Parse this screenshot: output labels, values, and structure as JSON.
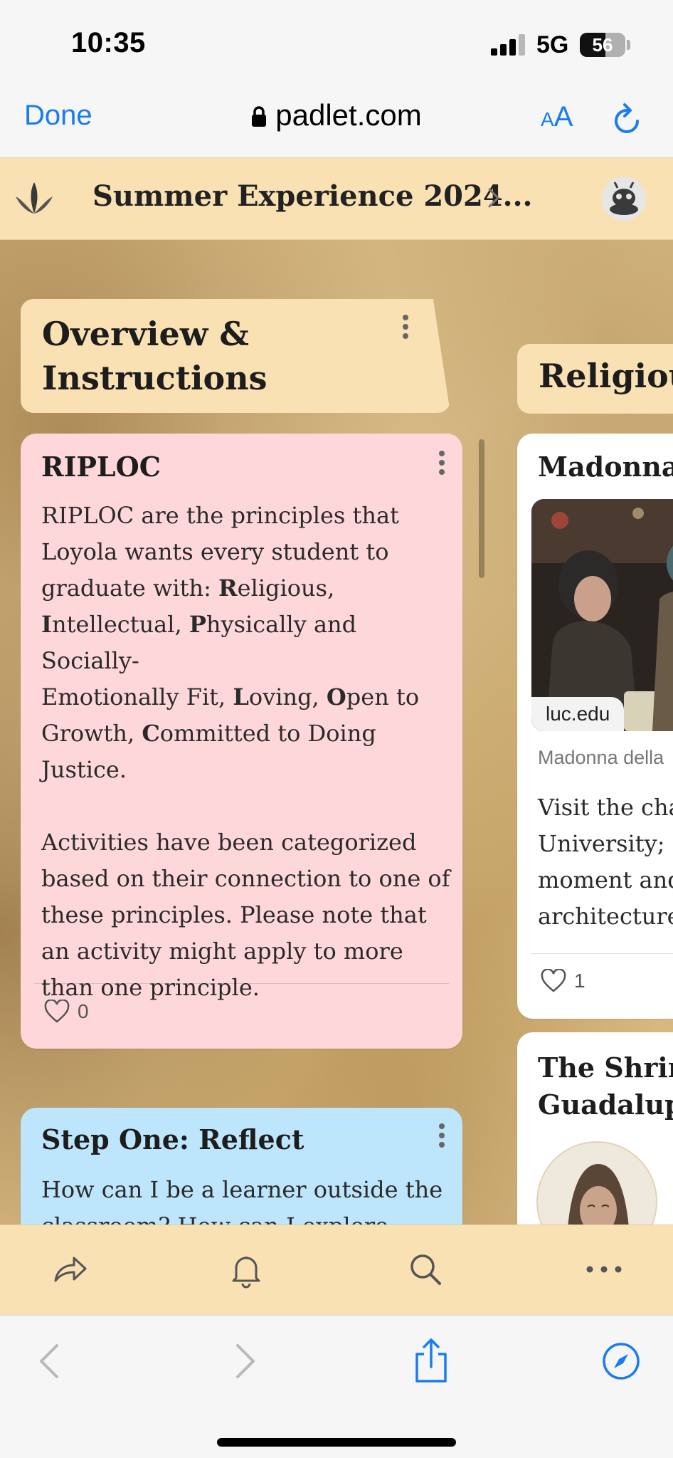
{
  "status_bar": {
    "time": "10:35",
    "network": "5G",
    "battery": "56"
  },
  "browser": {
    "done_label": "Done",
    "url": "padlet.com",
    "text_size_label_small": "A",
    "text_size_label_large": "A"
  },
  "padlet": {
    "title": "Summer Experience 2024...",
    "sections": [
      {
        "title": "Overview & Instructions"
      },
      {
        "title": "Religious"
      }
    ],
    "cards": {
      "ripl": {
        "title": "RIPLOC",
        "body_line1": "RIPLOC are the principles that",
        "body_line2": "Loyola wants every student to",
        "body_line3_pre": "graduate with: ",
        "p_R": "R",
        "w_R": "eligious,",
        "p_I": "I",
        "w_I": "ntellectual, ",
        "p_P": "P",
        "w_P": "hysically and Socially-",
        "w_E": "Emotionally Fit, ",
        "p_L": "L",
        "w_L": "oving, ",
        "p_O": "O",
        "w_O": "pen to",
        "w_G": "Growth, ",
        "p_C": "C",
        "w_C": "ommitted to Doing",
        "w_J": "Justice.",
        "body2": "Activities have been categorized based on their connection to one of these principles. Please note that an activity might apply to more than one principle.",
        "likes": "0"
      },
      "step_one": {
        "title": "Step One: Reflect",
        "body": "How can I be a learner outside the classroom? How can I explore..."
      },
      "madonna": {
        "title": "Madonna",
        "link_chip": "luc.edu",
        "caption": "Madonna della",
        "body_lines": [
          "Visit the cha",
          "University; s",
          "moment and",
          "architecture"
        ],
        "likes": "1"
      },
      "shrine": {
        "title_line1": "The Shrin",
        "title_line2": "Guadalupe"
      }
    }
  },
  "icons": {
    "lock": "lock-icon",
    "reload": "reload-icon",
    "share": "share-arrow-icon",
    "bell": "bell-icon",
    "search": "search-icon",
    "more": "more-icon",
    "back": "back-chevron-icon",
    "forward": "forward-chevron-icon",
    "share_sheet": "share-sheet-icon",
    "compass": "compass-icon"
  },
  "colors": {
    "accent": "#1a7cf2",
    "header_bg": "#f9e1b3",
    "card_pink": "#fed7da",
    "card_blue": "#bde5fb"
  }
}
